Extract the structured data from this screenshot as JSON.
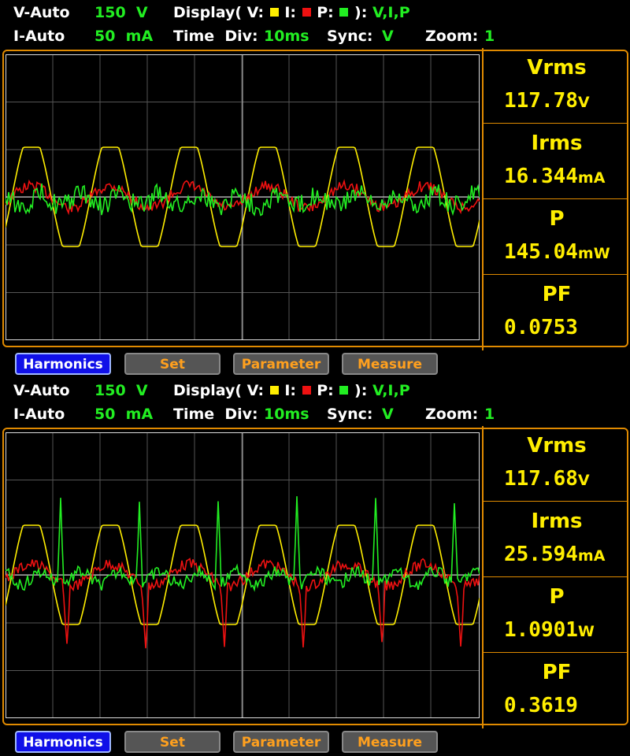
{
  "colors": {
    "voltage": "#ffee00",
    "current": "#ee1111",
    "power": "#22ee22",
    "accent": "#e08a00",
    "grid": "#555555"
  },
  "panels": [
    {
      "header": {
        "v_auto_label": "V-Auto",
        "v_range": "150  V",
        "i_auto_label": "I-Auto",
        "i_range": "50  mA",
        "display_label": "Display( V:",
        "i_label": "I:",
        "p_label": "P:",
        "display_close": "):",
        "display_value": "V,I,P",
        "time_div_label": "Time  Div:",
        "time_div_value": "10ms",
        "sync_label": "Sync:",
        "sync_value": "V",
        "zoom_label": "Zoom:",
        "zoom_value": "1"
      },
      "measurements": [
        {
          "label": "Vrms",
          "value": "117.78",
          "unit": "V"
        },
        {
          "label": "Irms",
          "value": "16.344",
          "unit": "mA"
        },
        {
          "label": "P",
          "value": "145.04",
          "unit": "mW"
        },
        {
          "label": "PF",
          "value": "0.0753",
          "unit": ""
        }
      ],
      "buttons": {
        "harmonics": "Harmonics",
        "set": "Set",
        "parameter": "Parameter",
        "measure": "Measure"
      }
    },
    {
      "header": {
        "v_auto_label": "V-Auto",
        "v_range": "150  V",
        "i_auto_label": "I-Auto",
        "i_range": "50  mA",
        "display_label": "Display( V:",
        "i_label": "I:",
        "p_label": "P:",
        "display_close": "):",
        "display_value": "V,I,P",
        "time_div_label": "Time  Div:",
        "time_div_value": "10ms",
        "sync_label": "Sync:",
        "sync_value": "V",
        "zoom_label": "Zoom:",
        "zoom_value": "1"
      },
      "measurements": [
        {
          "label": "Vrms",
          "value": "117.68",
          "unit": "V"
        },
        {
          "label": "Irms",
          "value": "25.594",
          "unit": "mA"
        },
        {
          "label": "P",
          "value": "1.0901",
          "unit": "W"
        },
        {
          "label": "PF",
          "value": "0.3619",
          "unit": ""
        }
      ],
      "buttons": {
        "harmonics": "Harmonics",
        "set": "Set",
        "parameter": "Parameter",
        "measure": "Measure"
      }
    }
  ]
}
